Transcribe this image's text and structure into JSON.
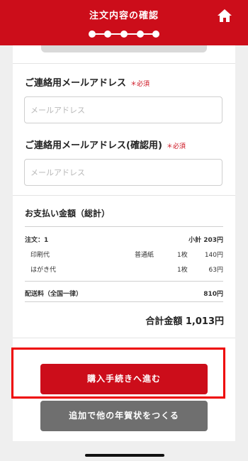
{
  "header": {
    "title": "注文内容の確認",
    "progress_steps": 5,
    "home_icon": "home-icon",
    "brand_color": "#cc0d1a"
  },
  "form": {
    "email": {
      "label": "ご連絡用メールアドレス",
      "required": "＊必須",
      "placeholder": "メールアドレス"
    },
    "email_confirm": {
      "label": "ご連絡用メールアドレス(確認用)",
      "required": "＊必須",
      "placeholder": "メールアドレス"
    }
  },
  "payment": {
    "title": "お支払い金額（総計）",
    "order_label": "注文：1",
    "subtotal": "小計 203円",
    "items": [
      {
        "name": "印刷代",
        "type": "普通紙",
        "qty": "1枚",
        "price": "140円"
      },
      {
        "name": "はがき代",
        "type": "",
        "qty": "1枚",
        "price": "63円"
      }
    ],
    "shipping_label": "配送料（全国一律）",
    "shipping_price": "810円",
    "total": "合計金額 1,013円"
  },
  "buttons": {
    "proceed": "購入手続きへ進む",
    "add_more": "追加で他の年賀状をつくる"
  }
}
